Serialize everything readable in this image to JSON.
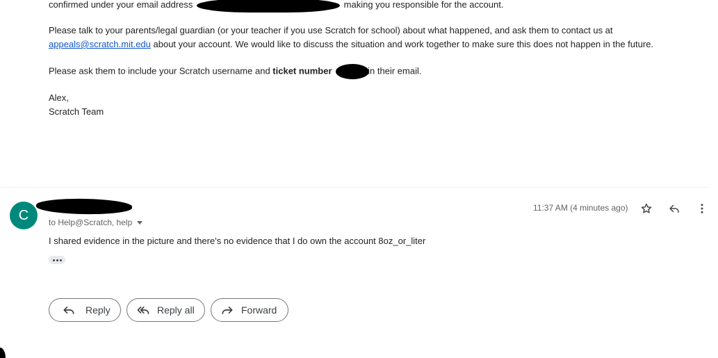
{
  "email_top": {
    "line1_before": "confirmed under your email address",
    "line1_after": "making you responsible for the account.",
    "para2_line1": "Please talk to your parents/legal guardian (or your teacher if you use Scratch for school) about what happened, and ask them to contact us at",
    "para2_link": "appeals@scratch.mit.edu",
    "para2_line2_after": "about your account. We would like to discuss the situation and work together to make sure this does not happen in the future.",
    "para3_before": "Please ask them to include your Scratch username and",
    "para3_bold": "ticket number",
    "para3_after": "in their email.",
    "signoff_name": "Alex,",
    "signoff_team": "Scratch Team"
  },
  "reply_message": {
    "avatar_letter": "C",
    "recipients": "to Help@Scratch, help",
    "timestamp": "11:37 AM (4 minutes ago)",
    "body": "I shared evidence in the picture and there's no evidence that I do own the account 8oz_or_liter"
  },
  "actions": {
    "reply_label": "Reply",
    "reply_all_label": "Reply all",
    "forward_label": "Forward"
  },
  "colors": {
    "avatar_bg": "#00897b",
    "link": "#1155cc",
    "button_border": "#747775"
  },
  "icons": {
    "star": "star-icon",
    "reply": "reply-icon",
    "more": "more-vert-icon",
    "reply_all": "reply-all-icon",
    "forward": "forward-icon"
  }
}
